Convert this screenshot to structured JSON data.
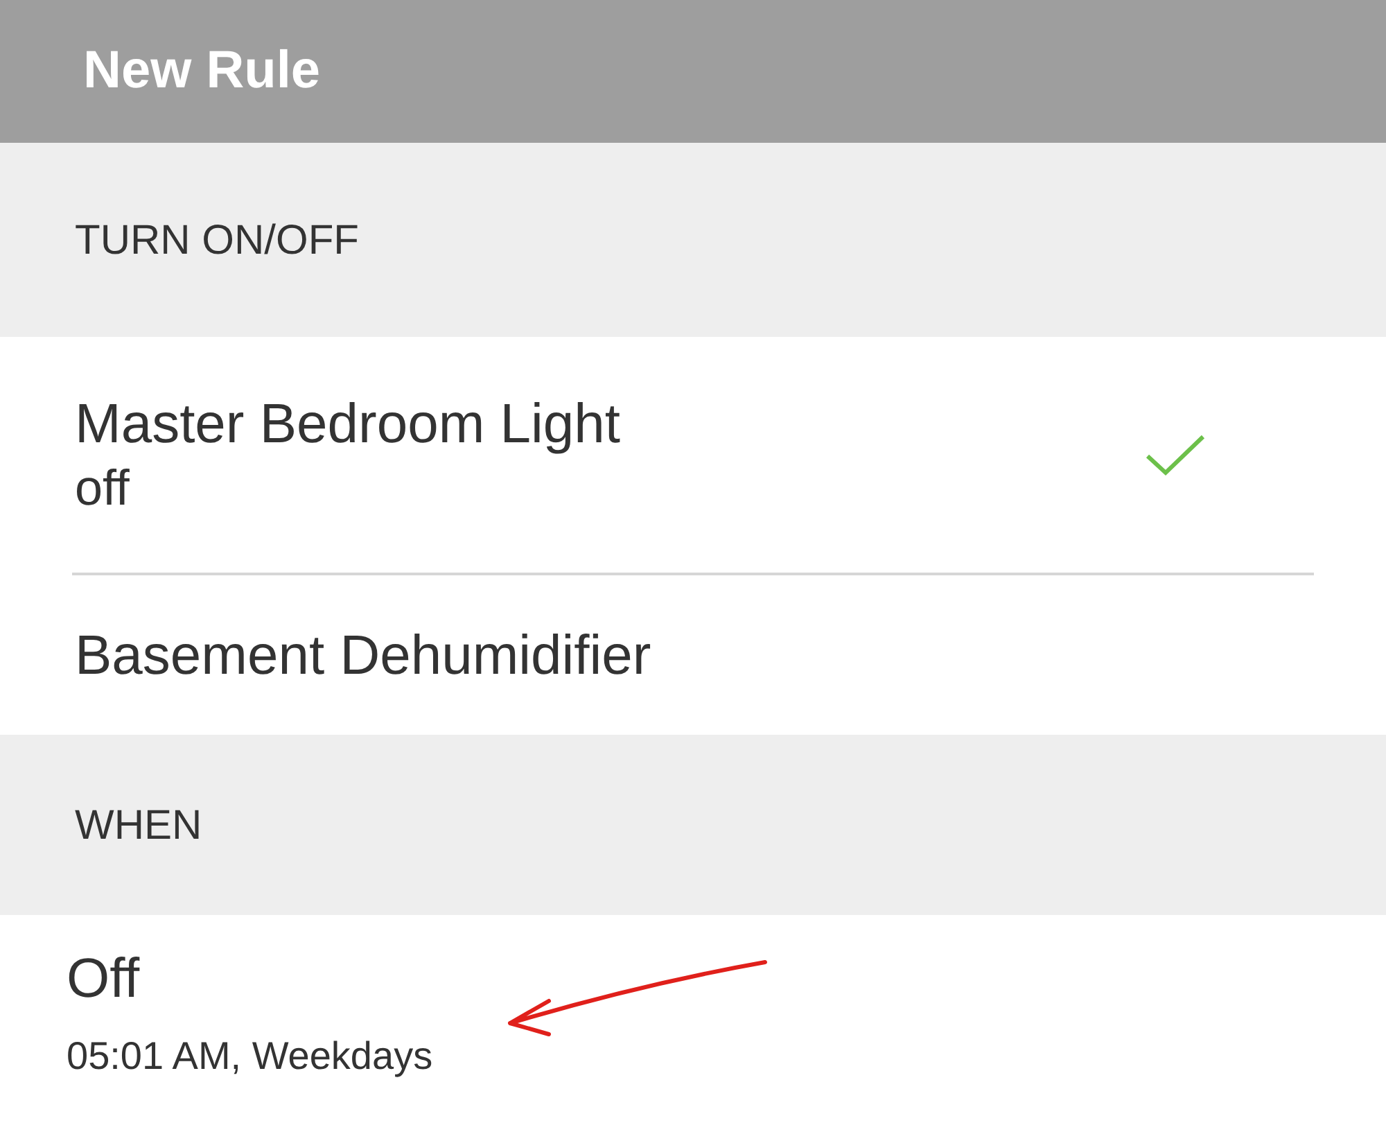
{
  "header": {
    "title": "New Rule"
  },
  "sections": [
    {
      "title": "TURN ON/OFF",
      "items": [
        {
          "kind": "device",
          "name": "Master Bedroom Light",
          "state": "off",
          "selected": true
        },
        {
          "kind": "device",
          "name": "Basement Dehumidifier",
          "selected": false
        }
      ]
    },
    {
      "title": "WHEN",
      "items": [
        {
          "kind": "schedule",
          "name": "Off",
          "detail": "05:01 AM, Weekdays",
          "annotated": true
        }
      ]
    }
  ]
}
